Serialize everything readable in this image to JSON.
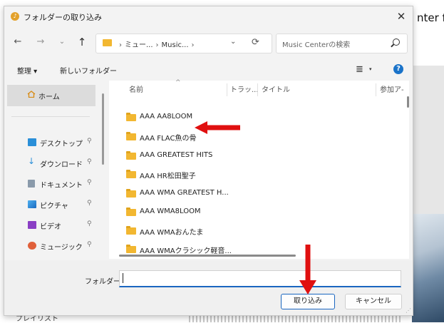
{
  "background": {
    "partial_title": "nter f",
    "bottom_text": "プレイリスト"
  },
  "dialog": {
    "title": "フォルダーの取り込み",
    "app_icon": "music-note-icon",
    "close_glyph": "✕"
  },
  "nav": {
    "back": "←",
    "forward": "→",
    "recent": "⌄",
    "up": "↑",
    "path_segments": [
      "ミュー...",
      "Music..."
    ],
    "refresh": "⟳",
    "search_placeholder": "Music Centerの検索"
  },
  "commands": {
    "organize": "整理 ▾",
    "new_folder": "新しいフォルダー",
    "view_glyph": "≣",
    "view_dropdown": "▾",
    "help": "?"
  },
  "sidebar": {
    "home": "ホーム",
    "items": [
      {
        "label": "デスクトップ",
        "icon": "desktop-icon",
        "color": "#2a8fd8"
      },
      {
        "label": "ダウンロード",
        "icon": "download-icon",
        "color": "#2a8fd8"
      },
      {
        "label": "ドキュメント",
        "icon": "document-icon",
        "color": "#7a8a9a"
      },
      {
        "label": "ピクチャ",
        "icon": "pictures-icon",
        "color": "#2a8fd8"
      },
      {
        "label": "ビデオ",
        "icon": "video-icon",
        "color": "#8a3fc4"
      },
      {
        "label": "ミュージック",
        "icon": "music-icon",
        "color": "#e0603a"
      }
    ],
    "pin_glyph": "📌"
  },
  "columns": [
    "名前",
    "トラッ...",
    "タイトル",
    "参加ア-"
  ],
  "sort_glyph": "^",
  "files": [
    "AAA AA8LOOM",
    "AAA FLAC魚の骨",
    "AAA GREATEST HITS",
    "AAA HR松田聖子",
    "AAA WMA GREATEST H...",
    "AAA WMA8LOOM",
    "AAA WMAおんたま",
    "AAA WMAクラシック軽音..."
  ],
  "footer": {
    "folder_label": "フォルダー:",
    "folder_value": "",
    "ok_button": "取り込み",
    "cancel_button": "キャンセル"
  },
  "colors": {
    "accent": "#1a66c0",
    "folder": "#f2b731",
    "annotation_arrow": "#e01010"
  }
}
